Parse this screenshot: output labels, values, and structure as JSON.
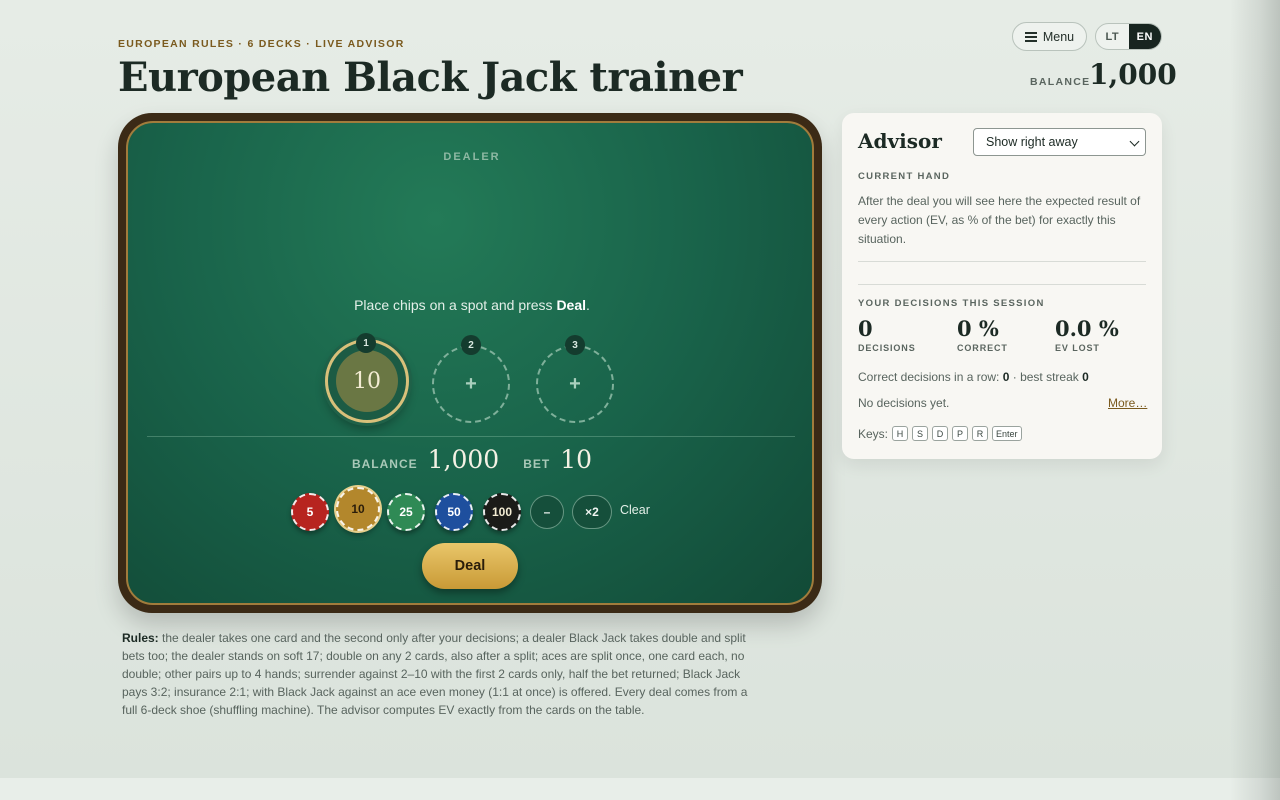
{
  "header": {
    "eyebrow": "EUROPEAN RULES · 6 DECKS · LIVE ADVISOR",
    "title": "European Black Jack trainer",
    "menu_label": "Menu",
    "languages": [
      "LT",
      "EN"
    ],
    "active_language": "EN",
    "balance_label": "BALANCE",
    "balance_value": "1,000"
  },
  "table": {
    "dealer_label": "DEALER",
    "instruction_prefix": "Place chips on a spot and press ",
    "instruction_action": "Deal",
    "instruction_suffix": ".",
    "spots": [
      {
        "number": "1",
        "bet": "10"
      },
      {
        "number": "2",
        "label": "+"
      },
      {
        "number": "3",
        "label": "+"
      }
    ],
    "balance_label": "BALANCE",
    "balance_value": "1,000",
    "bet_label": "BET",
    "bet_value": "10",
    "chips": [
      {
        "value": "5",
        "color": "#b7241f",
        "text_color": "#ffffff"
      },
      {
        "value": "10",
        "color": "#b3872c",
        "text_color": "#2a1d0a",
        "selected": true
      },
      {
        "value": "25",
        "color": "#2f8a55",
        "text_color": "#ffffff"
      },
      {
        "value": "50",
        "color": "#1e4f9e",
        "text_color": "#ffffff"
      },
      {
        "value": "100",
        "color": "#1b1b18",
        "text_color": "#f3ecd3"
      }
    ],
    "minus_label": "–",
    "double_label": "×2",
    "clear_label": "Clear",
    "deal_label": "Deal"
  },
  "rules": {
    "label": "Rules:",
    "text": "the dealer takes one card and the second only after your decisions; a dealer Black Jack takes double and split bets too; the dealer stands on soft 17; double on any 2 cards, also after a split; aces are split once, one card each, no double; other pairs up to 4 hands; surrender against 2–10 with the first 2 cards only, half the bet returned; Black Jack pays 3:2; insurance 2:1; with Black Jack against an ace even money (1:1 at once) is offered. Every deal comes from a full 6-deck shoe (shuffling machine). The advisor computes EV exactly from the cards on the table."
  },
  "advisor": {
    "title": "Advisor",
    "select_value": "Show right away",
    "current_hand_label": "CURRENT HAND",
    "current_hand_text": "After the deal you will see here the expected result of every action (EV, as % of the bet) for exactly this situation.",
    "session_label": "YOUR DECISIONS THIS SESSION",
    "stats": [
      {
        "value": "0",
        "label": "DECISIONS"
      },
      {
        "value": "0 %",
        "label": "CORRECT"
      },
      {
        "value": "0.0 %",
        "label": "EV LOST"
      }
    ],
    "streak_prefix": "Correct decisions in a row: ",
    "streak_value": "0",
    "streak_mid": " · best streak ",
    "best_streak_value": "0",
    "no_decisions_text": "No decisions yet.",
    "more_link": "More…",
    "keys_label": "Keys:",
    "keys": [
      "H",
      "S",
      "D",
      "P",
      "R",
      "Enter"
    ]
  },
  "colors": {
    "felt": "#19634a",
    "frame": "#3b2a16",
    "accent_gold": "#d8c07a",
    "link": "#7a5a1e"
  }
}
